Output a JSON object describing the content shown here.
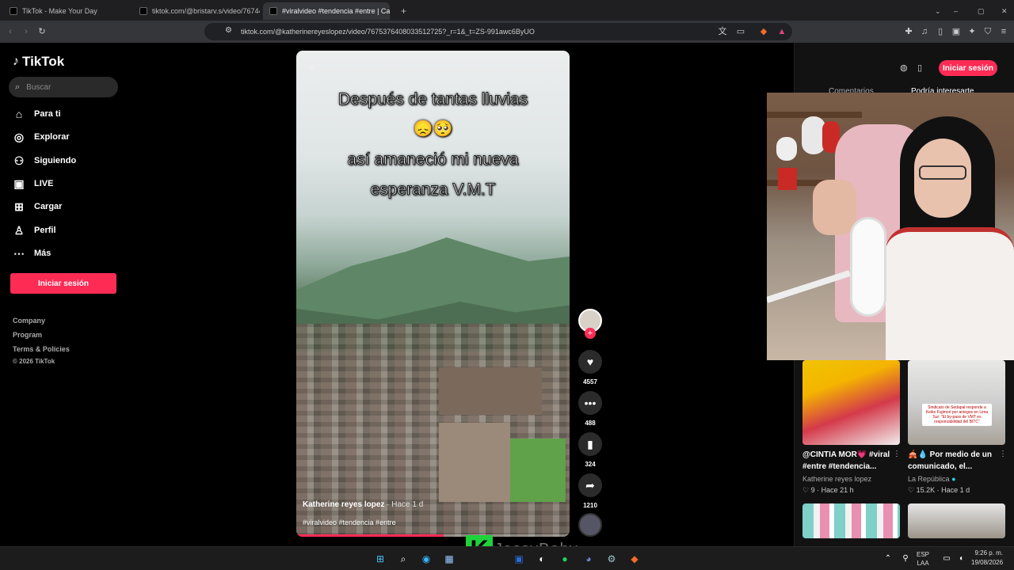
{
  "browser": {
    "tabs": [
      {
        "label": "TikTok - Make Your Day"
      },
      {
        "label": "tiktok.com/@bristarv.s/video/76744"
      },
      {
        "label": "#viralvideo #tendencia #entre | Ca"
      }
    ],
    "url": "tiktok.com/@katherinereyeslopez/video/7675376408033512725?_r=1&_t=ZS-991awc6ByUO"
  },
  "sidebar": {
    "logo": "TikTok",
    "search_placeholder": "Buscar",
    "nav": [
      {
        "label": "Para ti",
        "icon": "home-icon"
      },
      {
        "label": "Explorar",
        "icon": "compass-icon"
      },
      {
        "label": "Siguiendo",
        "icon": "following-icon"
      },
      {
        "label": "LIVE",
        "icon": "live-icon"
      },
      {
        "label": "Cargar",
        "icon": "upload-icon"
      },
      {
        "label": "Perfil",
        "icon": "profile-icon"
      },
      {
        "label": "Más",
        "icon": "more-icon"
      }
    ],
    "login_label": "Iniciar sesión",
    "footer": [
      "Company",
      "Program",
      "Terms & Policies"
    ],
    "copyright": "© 2026 TikTok"
  },
  "video": {
    "caption_line1": "Después de tantas lluvias",
    "caption_emoji": "😞🥺",
    "caption_line2": "así amaneció mi nueva",
    "caption_line3": "esperanza V.M.T",
    "author": "Katherine reyes lopez",
    "time": "· Hace 1 d",
    "tags": "#viralvideo #tendencia #entre",
    "progress_fraction": 0.54
  },
  "actions": {
    "likes": "4557",
    "comments": "488",
    "saves": "324",
    "shares": "1210"
  },
  "right_panel": {
    "login_label": "Iniciar sesión",
    "tab_comments": "Comentarios",
    "tab_related": "Podría interesarte",
    "recommended": [
      {
        "title": "@CINTIA MOR💗 #viral #entre #tendencia...",
        "author": "Katherine reyes lopez",
        "meta": "♡ 9 · Hace 21 h"
      },
      {
        "title": "🎪💧 Por medio de un comunicado, el...",
        "author": "La República",
        "meta": "♡ 15.2K · Hace 1 d",
        "thumb_text": "Sindicato de Sedapal responde a Keiko Fujimori por aniegos en Lima Sur: \"El by-pass de VMT es responsabilidad del BITC\""
      }
    ]
  },
  "overlay": {
    "watermark_letter": "K",
    "watermark_name": "JessyBaby"
  },
  "taskbar": {
    "lang_top": "ESP",
    "lang_bottom": "LAA",
    "time": "9:26 p. m.",
    "date": "19/08/2026"
  },
  "colors": {
    "accent": "#fe2c55",
    "background": "#000000"
  }
}
